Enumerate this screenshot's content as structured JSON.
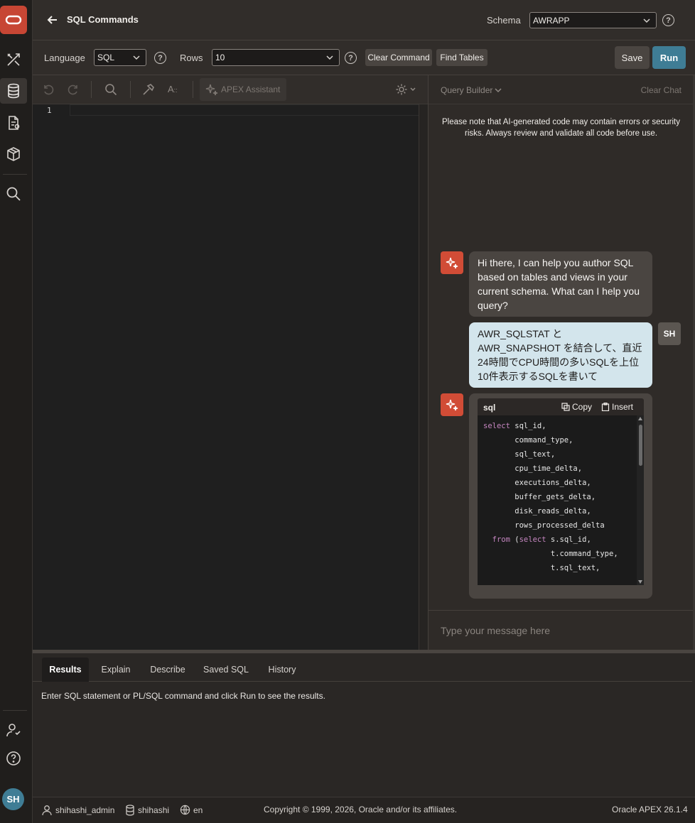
{
  "rail": {
    "items": [
      "app-builder",
      "sql-workshop",
      "data-workshop",
      "gallery",
      "search"
    ],
    "bottom": [
      "administration",
      "help"
    ],
    "avatar": "SH"
  },
  "header": {
    "title": "SQL Commands",
    "schema_label": "Schema",
    "schema_value": "AWRAPP"
  },
  "toolbar": {
    "language_label": "Language",
    "language_value": "SQL",
    "rows_label": "Rows",
    "rows_value": "10",
    "clear_command": "Clear Command",
    "find_tables": "Find Tables",
    "save": "Save",
    "run": "Run"
  },
  "editor": {
    "apex_assistant": "APEX Assistant",
    "font_size_icon": "A",
    "line_numbers": [
      "1"
    ]
  },
  "chat": {
    "query_builder": "Query Builder",
    "clear_chat": "Clear Chat",
    "notice": "Please note that AI-generated code may contain errors or security risks. Always review and validate all code before use.",
    "greeting": "Hi there, I can help you author SQL based on tables and views in your current schema. What can I help you query?",
    "user_avatar": "SH",
    "user_message": "AWR_SQLSTAT と AWR_SNAPSHOT を結合して、直近24時間でCPU時間の多いSQLを上位10件表示するSQLを書いて",
    "code_lang": "sql",
    "copy": "Copy",
    "insert": "Insert",
    "code_lines": [
      "select sql_id,",
      "       command_type,",
      "       sql_text,",
      "       cpu_time_delta,",
      "       executions_delta,",
      "       buffer_gets_delta,",
      "       disk_reads_delta,",
      "       rows_processed_delta",
      "  from (select s.sql_id,",
      "               t.command_type,",
      "               t.sql_text,"
    ],
    "input_placeholder": "Type your message here"
  },
  "results": {
    "tabs": [
      "Results",
      "Explain",
      "Describe",
      "Saved SQL",
      "History"
    ],
    "active_tab": "Results",
    "message": "Enter SQL statement or PL/SQL command and click Run to see the results."
  },
  "footer": {
    "user": "shihashi_admin",
    "schema": "shihashi",
    "language": "en",
    "copyright": "Copyright © 1999, 2026, Oracle and/or its affiliates.",
    "version": "Oracle APEX 26.1.4"
  },
  "colors": {
    "accent": "#3f7d95",
    "assistant": "#d14c36",
    "oracle_red": "#c74634",
    "user_bubble": "#d3e5ec"
  }
}
